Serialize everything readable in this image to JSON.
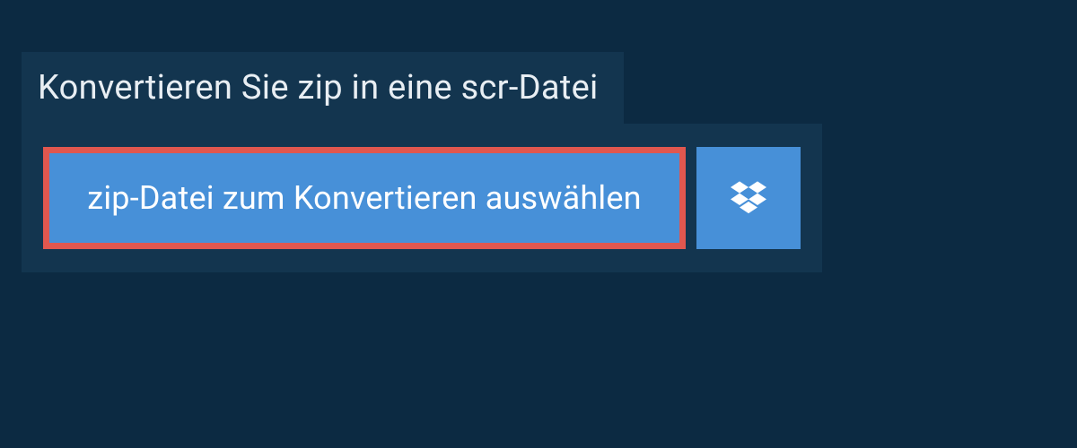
{
  "header": {
    "title": "Konvertieren Sie zip in eine scr-Datei"
  },
  "upload": {
    "select_label": "zip-Datei zum Konvertieren auswählen",
    "dropbox_icon": "dropbox-icon"
  },
  "colors": {
    "background": "#0c2a42",
    "panel": "#13354f",
    "button": "#4790d8",
    "highlight_border": "#e0574f",
    "text_light": "#e8eef3",
    "text_white": "#ffffff"
  }
}
